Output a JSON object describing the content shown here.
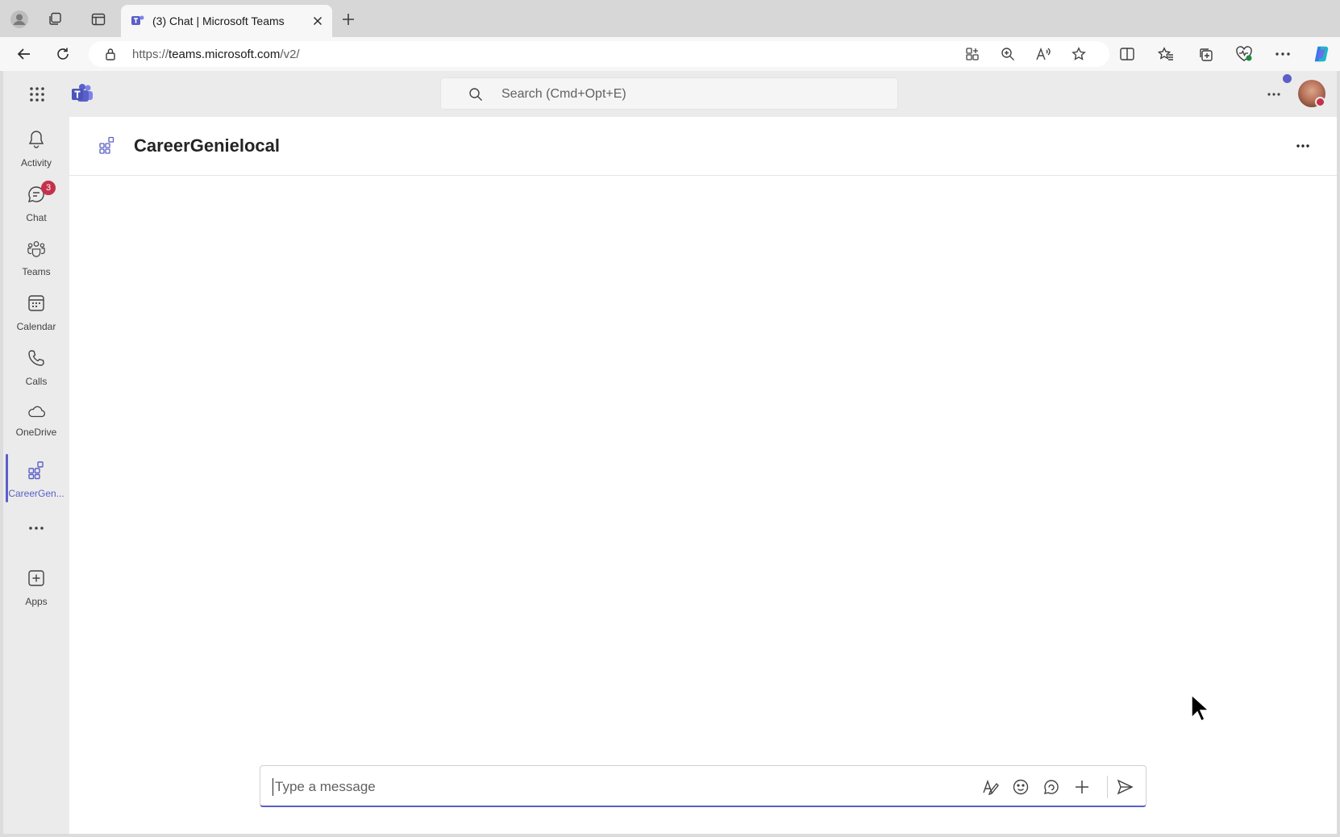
{
  "browser": {
    "tab_title": "(3) Chat | Microsoft Teams",
    "url_prefix": "https://",
    "url_host": "teams.microsoft.com",
    "url_path": "/v2/"
  },
  "teams": {
    "search_placeholder": "Search (Cmd+Opt+E)",
    "rail": [
      {
        "label": "Activity",
        "icon": "bell-icon"
      },
      {
        "label": "Chat",
        "icon": "chat-icon",
        "badge": "3"
      },
      {
        "label": "Teams",
        "icon": "teams-icon"
      },
      {
        "label": "Calendar",
        "icon": "calendar-icon"
      },
      {
        "label": "Calls",
        "icon": "phone-icon"
      },
      {
        "label": "OneDrive",
        "icon": "cloud-icon"
      },
      {
        "label": "CareerGen...",
        "icon": "app-grid-icon",
        "active": true
      },
      {
        "label": "Apps",
        "icon": "add-app-icon"
      }
    ],
    "app_title": "CareerGenielocal",
    "composer_placeholder": "Type a message"
  },
  "colors": {
    "accent": "#5b5fc7",
    "badge": "#c4314b",
    "rail_bg": "#ebebeb"
  }
}
